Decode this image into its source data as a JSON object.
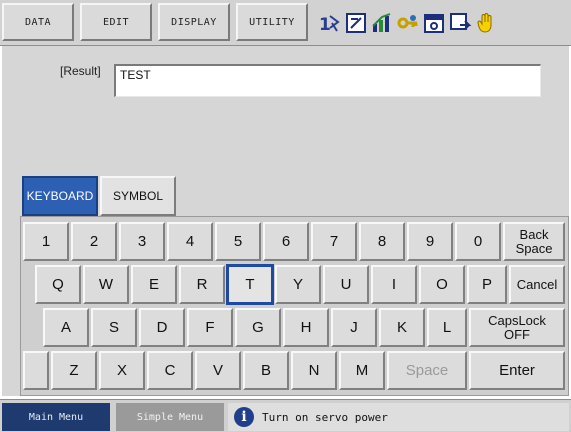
{
  "menu": {
    "tabs": [
      "DATA",
      "EDIT",
      "DISPLAY",
      "UTILITY"
    ]
  },
  "status_icons": [
    "step-mode-icon",
    "edit-sheet-icon",
    "chart-icon",
    "key-icon",
    "calendar-icon",
    "save-icon",
    "hand-icon"
  ],
  "result": {
    "label": "[Result]",
    "value": "TEST"
  },
  "modes": {
    "keyboard": "KEYBOARD",
    "symbol": "SYMBOL"
  },
  "keyboard": {
    "row1": [
      "1",
      "2",
      "3",
      "4",
      "5",
      "6",
      "7",
      "8",
      "9",
      "0"
    ],
    "back_space": [
      "Back",
      "Space"
    ],
    "row2": [
      "Q",
      "W",
      "E",
      "R",
      "T",
      "Y",
      "U",
      "I",
      "O",
      "P"
    ],
    "cancel": "Cancel",
    "row3": [
      "A",
      "S",
      "D",
      "F",
      "G",
      "H",
      "J",
      "K",
      "L"
    ],
    "capslock": [
      "CapsLock",
      "OFF"
    ],
    "row4": [
      "Z",
      "X",
      "C",
      "V",
      "B",
      "N",
      "M"
    ],
    "space": "Space",
    "enter": "Enter",
    "active_key": "T"
  },
  "bottom": {
    "main_menu": "Main Menu",
    "simple_menu": "Simple Menu",
    "message": "Turn on servo power"
  }
}
